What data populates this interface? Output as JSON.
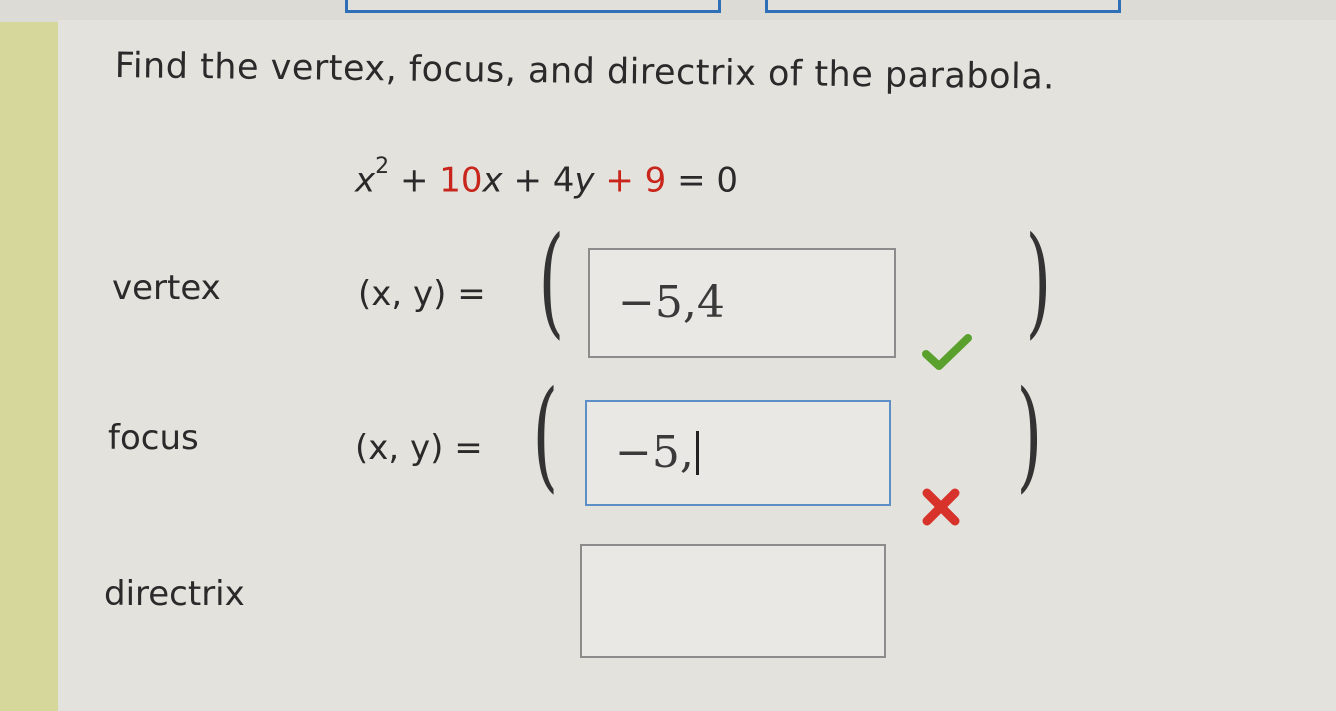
{
  "question": {
    "title": "Find the vertex, focus, and directrix of the parabola.",
    "equation": {
      "x": "x",
      "exp": "2",
      "op1": "+",
      "c10": "10",
      "x2": "x",
      "op2": "+",
      "c4": "4",
      "y": "y",
      "op3": "+",
      "c9": "9",
      "eq": "=",
      "rhs": "0"
    }
  },
  "rows": {
    "vertex": {
      "label": "vertex",
      "lhs": "(x, y) =",
      "value": "−5,4",
      "status": "correct"
    },
    "focus": {
      "label": "focus",
      "lhs": "(x, y) =",
      "value": "−5,",
      "status": "incorrect"
    },
    "directrix": {
      "label": "directrix",
      "value": ""
    }
  },
  "symbols": {
    "open_paren": "(",
    "close_paren": ")"
  },
  "icons": {
    "correct": "check-icon",
    "incorrect": "x-mark-icon"
  },
  "colors": {
    "correct": "#5aa02c",
    "incorrect": "#d8332b",
    "highlight": "#c8261c",
    "focus_border": "#5d8fc7"
  }
}
